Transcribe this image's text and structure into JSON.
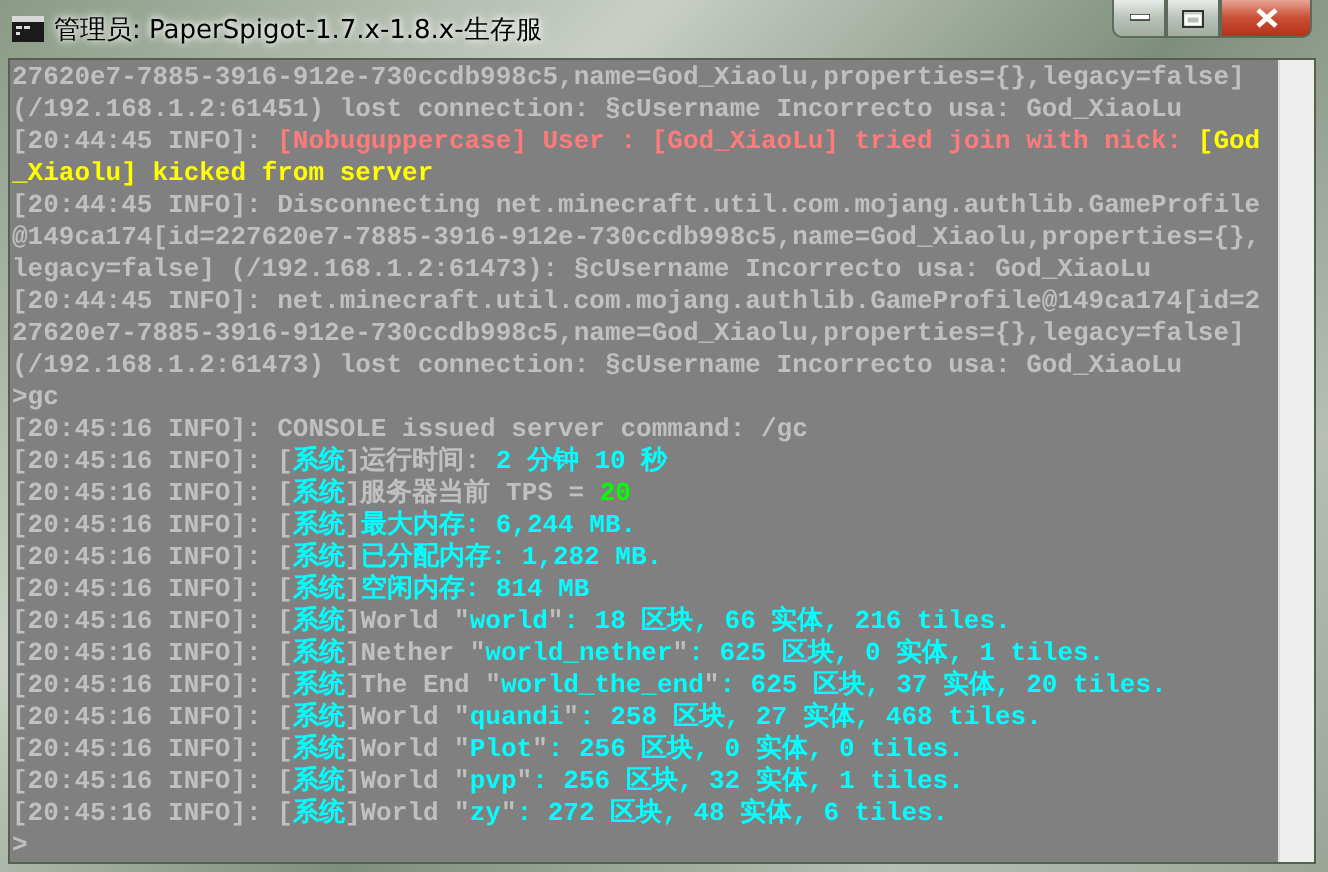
{
  "window": {
    "title": "管理员: PaperSpigot-1.7.x-1.8.x-生存服"
  },
  "console": {
    "lines": [
      {
        "segments": [
          {
            "text": "27620e7-7885-3916-912e-730ccdb998c5,name=God_Xiaolu,properties={},legacy=false]",
            "color": "#c0c0c0"
          }
        ]
      },
      {
        "segments": [
          {
            "text": "(/192.168.1.2:61451) lost connection: §cUsername Incorrecto usa: God_XiaoLu",
            "color": "#c0c0c0"
          }
        ]
      },
      {
        "segments": [
          {
            "text": "[20:44:45 INFO]: ",
            "color": "#c0c0c0"
          },
          {
            "text": "[Nobuguppercase] User : [God_XiaoLu] tried join with nick: ",
            "color": "#ff7a7a"
          },
          {
            "text": "[God",
            "color": "#ffff00"
          }
        ]
      },
      {
        "segments": [
          {
            "text": "_Xiaolu] kicked from server",
            "color": "#ffff00"
          }
        ]
      },
      {
        "segments": [
          {
            "text": "[20:44:45 INFO]: Disconnecting net.minecraft.util.com.mojang.authlib.GameProfile",
            "color": "#c0c0c0"
          }
        ]
      },
      {
        "segments": [
          {
            "text": "@149ca174[id=227620e7-7885-3916-912e-730ccdb998c5,name=God_Xiaolu,properties={},",
            "color": "#c0c0c0"
          }
        ]
      },
      {
        "segments": [
          {
            "text": "legacy=false] (/192.168.1.2:61473): §cUsername Incorrecto usa: God_XiaoLu",
            "color": "#c0c0c0"
          }
        ]
      },
      {
        "segments": [
          {
            "text": "[20:44:45 INFO]: net.minecraft.util.com.mojang.authlib.GameProfile@149ca174[id=2",
            "color": "#c0c0c0"
          }
        ]
      },
      {
        "segments": [
          {
            "text": "27620e7-7885-3916-912e-730ccdb998c5,name=God_Xiaolu,properties={},legacy=false]",
            "color": "#c0c0c0"
          }
        ]
      },
      {
        "segments": [
          {
            "text": "(/192.168.1.2:61473) lost connection: §cUsername Incorrecto usa: God_XiaoLu",
            "color": "#c0c0c0"
          }
        ]
      },
      {
        "segments": [
          {
            "text": ">gc",
            "color": "#c0c0c0"
          }
        ]
      },
      {
        "segments": [
          {
            "text": "[20:45:16 INFO]: CONSOLE issued server command: /gc",
            "color": "#c0c0c0"
          }
        ]
      },
      {
        "segments": [
          {
            "text": "[20:45:16 INFO]: [",
            "color": "#c0c0c0"
          },
          {
            "text": "系统",
            "color": "#00ffff"
          },
          {
            "text": "]运行时间: ",
            "color": "#c0c0c0"
          },
          {
            "text": "2 分钟 10 秒",
            "color": "#00ffff"
          }
        ]
      },
      {
        "segments": [
          {
            "text": "[20:45:16 INFO]: [",
            "color": "#c0c0c0"
          },
          {
            "text": "系统",
            "color": "#00ffff"
          },
          {
            "text": "]服务器当前 TPS = ",
            "color": "#c0c0c0"
          },
          {
            "text": "20",
            "color": "#00ff00"
          }
        ]
      },
      {
        "segments": [
          {
            "text": "[20:45:16 INFO]: [",
            "color": "#c0c0c0"
          },
          {
            "text": "系统",
            "color": "#00ffff"
          },
          {
            "text": "]",
            "color": "#c0c0c0"
          },
          {
            "text": "最大内存: 6,244 MB.",
            "color": "#00ffff"
          }
        ]
      },
      {
        "segments": [
          {
            "text": "[20:45:16 INFO]: [",
            "color": "#c0c0c0"
          },
          {
            "text": "系统",
            "color": "#00ffff"
          },
          {
            "text": "]",
            "color": "#c0c0c0"
          },
          {
            "text": "已分配内存: 1,282 MB.",
            "color": "#00ffff"
          }
        ]
      },
      {
        "segments": [
          {
            "text": "[20:45:16 INFO]: [",
            "color": "#c0c0c0"
          },
          {
            "text": "系统",
            "color": "#00ffff"
          },
          {
            "text": "]",
            "color": "#c0c0c0"
          },
          {
            "text": "空闲内存: 814 MB",
            "color": "#00ffff"
          }
        ]
      },
      {
        "segments": [
          {
            "text": "[20:45:16 INFO]: [",
            "color": "#c0c0c0"
          },
          {
            "text": "系统",
            "color": "#00ffff"
          },
          {
            "text": "]World \"",
            "color": "#c0c0c0"
          },
          {
            "text": "world",
            "color": "#00ffff"
          },
          {
            "text": "\"",
            "color": "#c0c0c0"
          },
          {
            "text": ": 18 区块, 66 实体, 216 tiles.",
            "color": "#00ffff"
          }
        ]
      },
      {
        "segments": [
          {
            "text": "[20:45:16 INFO]: [",
            "color": "#c0c0c0"
          },
          {
            "text": "系统",
            "color": "#00ffff"
          },
          {
            "text": "]Nether \"",
            "color": "#c0c0c0"
          },
          {
            "text": "world_nether",
            "color": "#00ffff"
          },
          {
            "text": "\"",
            "color": "#c0c0c0"
          },
          {
            "text": ": 625 区块, 0 实体, 1 tiles.",
            "color": "#00ffff"
          }
        ]
      },
      {
        "segments": [
          {
            "text": "[20:45:16 INFO]: [",
            "color": "#c0c0c0"
          },
          {
            "text": "系统",
            "color": "#00ffff"
          },
          {
            "text": "]The End \"",
            "color": "#c0c0c0"
          },
          {
            "text": "world_the_end",
            "color": "#00ffff"
          },
          {
            "text": "\"",
            "color": "#c0c0c0"
          },
          {
            "text": ": 625 区块, 37 实体, 20 tiles.",
            "color": "#00ffff"
          }
        ]
      },
      {
        "segments": [
          {
            "text": "[20:45:16 INFO]: [",
            "color": "#c0c0c0"
          },
          {
            "text": "系统",
            "color": "#00ffff"
          },
          {
            "text": "]World \"",
            "color": "#c0c0c0"
          },
          {
            "text": "quandi",
            "color": "#00ffff"
          },
          {
            "text": "\"",
            "color": "#c0c0c0"
          },
          {
            "text": ": 258 区块, 27 实体, 468 tiles.",
            "color": "#00ffff"
          }
        ]
      },
      {
        "segments": [
          {
            "text": "[20:45:16 INFO]: [",
            "color": "#c0c0c0"
          },
          {
            "text": "系统",
            "color": "#00ffff"
          },
          {
            "text": "]World \"",
            "color": "#c0c0c0"
          },
          {
            "text": "Plot",
            "color": "#00ffff"
          },
          {
            "text": "\"",
            "color": "#c0c0c0"
          },
          {
            "text": ": 256 区块, 0 实体, 0 tiles.",
            "color": "#00ffff"
          }
        ]
      },
      {
        "segments": [
          {
            "text": "[20:45:16 INFO]: [",
            "color": "#c0c0c0"
          },
          {
            "text": "系统",
            "color": "#00ffff"
          },
          {
            "text": "]World \"",
            "color": "#c0c0c0"
          },
          {
            "text": "pvp",
            "color": "#00ffff"
          },
          {
            "text": "\"",
            "color": "#c0c0c0"
          },
          {
            "text": ": 256 区块, 32 实体, 1 tiles.",
            "color": "#00ffff"
          }
        ]
      },
      {
        "segments": [
          {
            "text": "[20:45:16 INFO]: [",
            "color": "#c0c0c0"
          },
          {
            "text": "系统",
            "color": "#00ffff"
          },
          {
            "text": "]World \"",
            "color": "#c0c0c0"
          },
          {
            "text": "zy",
            "color": "#00ffff"
          },
          {
            "text": "\"",
            "color": "#c0c0c0"
          },
          {
            "text": ": 272 区块, 48 实体, 6 tiles.",
            "color": "#00ffff"
          }
        ]
      },
      {
        "segments": [
          {
            "text": ">",
            "color": "#c0c0c0"
          }
        ]
      }
    ]
  }
}
